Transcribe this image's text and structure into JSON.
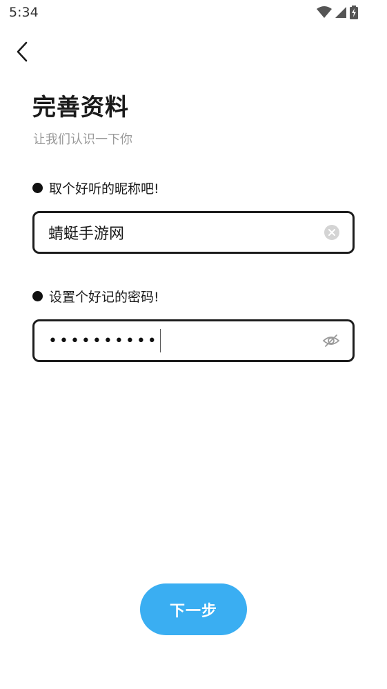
{
  "status_bar": {
    "time": "5:34"
  },
  "header": {
    "title": "完善资料",
    "subtitle": "让我们认识一下你"
  },
  "nickname": {
    "label": "取个好听的昵称吧!",
    "value": "蜻蜓手游网"
  },
  "password": {
    "label": "设置个好记的密码!",
    "masked_value": "••••••••••"
  },
  "footer": {
    "next_label": "下一步"
  },
  "colors": {
    "accent": "#3aaef2",
    "border": "#1c1c1c",
    "subtitle": "#9a9a9a"
  }
}
